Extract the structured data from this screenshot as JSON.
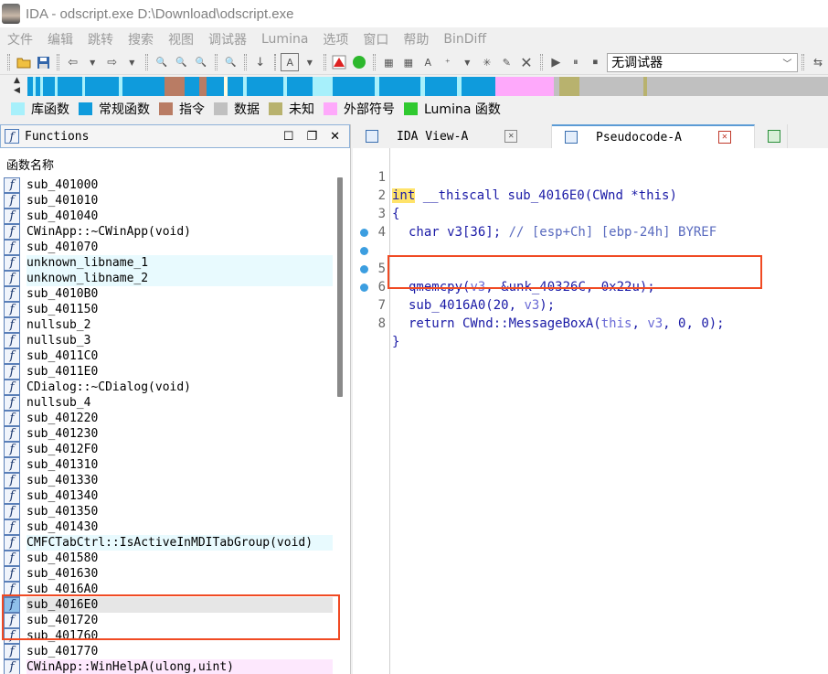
{
  "window": {
    "title": "IDA - odscript.exe D:\\Download\\odscript.exe"
  },
  "menu": [
    "文件",
    "编辑",
    "跳转",
    "搜索",
    "视图",
    "调试器",
    "Lumina",
    "选项",
    "窗口",
    "帮助",
    "BinDiff"
  ],
  "toolbar": {
    "debugger_select": "无调试器"
  },
  "legend": [
    {
      "label": "库函数",
      "color": "#a7f0fb"
    },
    {
      "label": "常规函数",
      "color": "#0f9bdc"
    },
    {
      "label": "指令",
      "color": "#b97c64"
    },
    {
      "label": "数据",
      "color": "#c0c0c0"
    },
    {
      "label": "未知",
      "color": "#b8b26e"
    },
    {
      "label": "外部符号",
      "color": "#fea9fb"
    },
    {
      "label": "Lumina 函数",
      "color": "#2fc92f"
    }
  ],
  "functions_panel": {
    "title": "Functions",
    "column_header": "函数名称",
    "items": [
      {
        "name": "sub_401000",
        "kind": "regular"
      },
      {
        "name": "sub_401010",
        "kind": "regular"
      },
      {
        "name": "sub_401040",
        "kind": "regular"
      },
      {
        "name": "CWinApp::~CWinApp(void)",
        "kind": "regular"
      },
      {
        "name": "sub_401070",
        "kind": "regular"
      },
      {
        "name": "unknown_libname_1",
        "kind": "library"
      },
      {
        "name": "unknown_libname_2",
        "kind": "library"
      },
      {
        "name": "sub_4010B0",
        "kind": "regular"
      },
      {
        "name": "sub_401150",
        "kind": "regular"
      },
      {
        "name": "nullsub_2",
        "kind": "regular"
      },
      {
        "name": "nullsub_3",
        "kind": "regular"
      },
      {
        "name": "sub_4011C0",
        "kind": "regular"
      },
      {
        "name": "sub_4011E0",
        "kind": "regular"
      },
      {
        "name": "CDialog::~CDialog(void)",
        "kind": "regular"
      },
      {
        "name": "nullsub_4",
        "kind": "regular"
      },
      {
        "name": "sub_401220",
        "kind": "regular"
      },
      {
        "name": "sub_401230",
        "kind": "regular"
      },
      {
        "name": "sub_4012F0",
        "kind": "regular"
      },
      {
        "name": "sub_401310",
        "kind": "regular"
      },
      {
        "name": "sub_401330",
        "kind": "regular"
      },
      {
        "name": "sub_401340",
        "kind": "regular"
      },
      {
        "name": "sub_401350",
        "kind": "regular"
      },
      {
        "name": "sub_401430",
        "kind": "regular"
      },
      {
        "name": "CMFCTabCtrl::IsActiveInMDITabGroup(void)",
        "kind": "library"
      },
      {
        "name": "sub_401580",
        "kind": "regular"
      },
      {
        "name": "sub_401630",
        "kind": "regular"
      },
      {
        "name": "sub_4016A0",
        "kind": "regular"
      },
      {
        "name": "sub_4016E0",
        "kind": "selected"
      },
      {
        "name": "sub_401720",
        "kind": "regular"
      },
      {
        "name": "sub_401760",
        "kind": "regular"
      },
      {
        "name": "sub_401770",
        "kind": "regular"
      },
      {
        "name": "CWinApp::WinHelpA(ulong,uint)",
        "kind": "external"
      }
    ]
  },
  "tabs": [
    {
      "label": "IDA View-A",
      "active": false
    },
    {
      "label": "Pseudocode-A",
      "active": true
    }
  ],
  "code": {
    "line_numbers": [
      "1",
      "2",
      "3",
      "4",
      "5",
      "6",
      "7",
      "8"
    ],
    "line1_type": "int",
    "line1_rest": " __thiscall sub_4016E0(CWnd *this)",
    "line2": "{",
    "line3_type": "char",
    "line3_rest": " v3[36]; ",
    "line3_comment": "// [esp+Ch] [ebp-24h] BYREF",
    "line5_fn": "qmemcpy(",
    "line5_arg": "v3",
    "line5_rest": ", &unk_40326C, 0x22u);",
    "line6_fn": "sub_4016A0(20, ",
    "line6_arg": "v3",
    "line6_end": ");",
    "line7_kw": "return",
    "line7_fn": " CWnd::MessageBoxA(",
    "line7_this": "this",
    "line7_sep": ", ",
    "line7_arg": "v3",
    "line7_end": ", 0, 0);",
    "line8": "}"
  }
}
